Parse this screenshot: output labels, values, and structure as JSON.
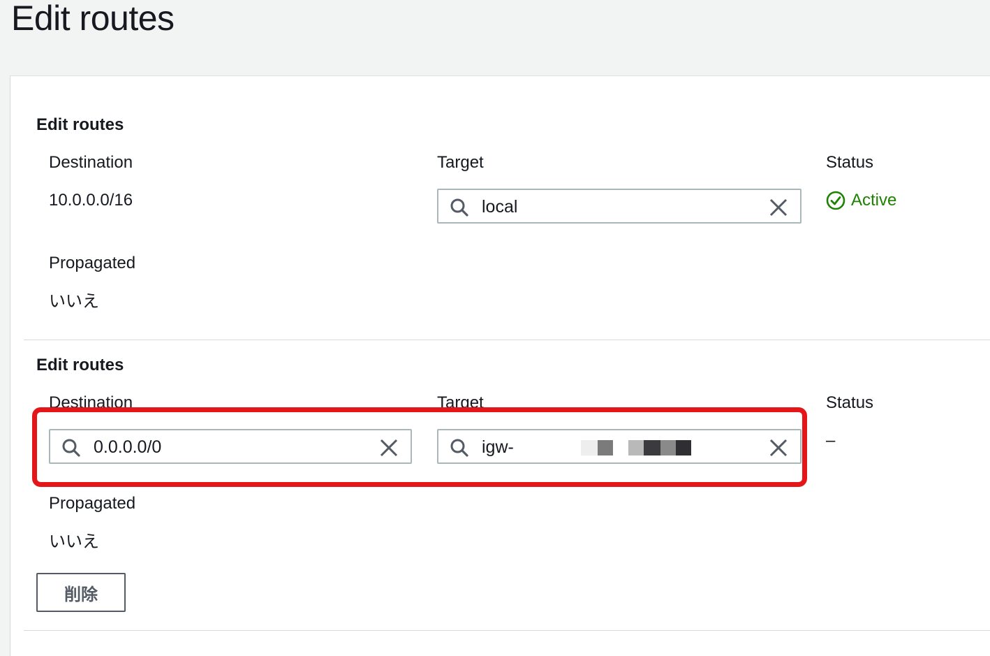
{
  "page": {
    "title": "Edit routes"
  },
  "routes": [
    {
      "section_title": "Edit routes",
      "destination_label": "Destination",
      "destination_value": "10.0.0.0/16",
      "target_label": "Target",
      "target_value": "local",
      "status_label": "Status",
      "status_value": "Active",
      "propagated_label": "Propagated",
      "propagated_value": "いいえ"
    },
    {
      "section_title": "Edit routes",
      "destination_label": "Destination",
      "destination_value": "0.0.0.0/0",
      "target_label": "Target",
      "target_value": "igw-",
      "status_label": "Status",
      "status_value": "–",
      "propagated_label": "Propagated",
      "propagated_value": "いいえ",
      "delete_label": "削除"
    }
  ],
  "colors": {
    "active": "#1d8102",
    "highlight": "#e5161a",
    "text": "#16191f",
    "border": "#aab7b8"
  },
  "icons": [
    "search-icon",
    "close-icon",
    "check-circle-icon"
  ]
}
